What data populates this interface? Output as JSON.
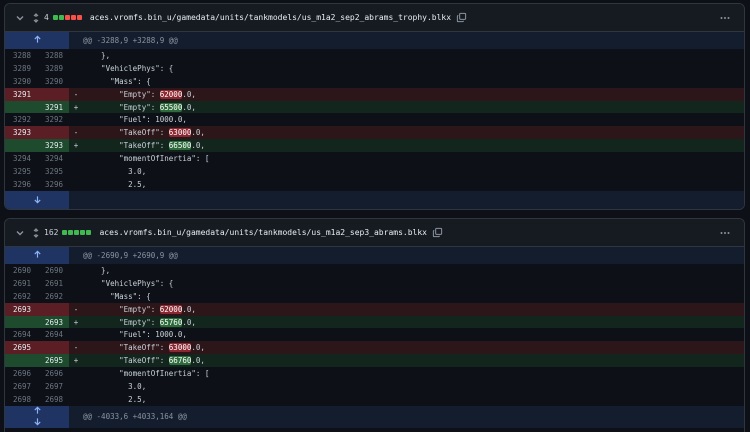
{
  "files": [
    {
      "count": "4",
      "filename": "aces.vromfs.bin_u/gamedata/units/tankmodels/us_m1a2_sep2_abrams_trophy.blkx",
      "diffstat": [
        "add",
        "add",
        "del",
        "del",
        "del"
      ],
      "hunk_top": "@@ -3288,9 +3288,9 @@",
      "lines": [
        {
          "type": "ctx",
          "old": "3288",
          "new": "3288",
          "mark": "",
          "pre": "    },",
          "hl": "",
          "post": ""
        },
        {
          "type": "ctx",
          "old": "3289",
          "new": "3289",
          "mark": "",
          "pre": "    \"VehiclePhys\": {",
          "hl": "",
          "post": ""
        },
        {
          "type": "ctx",
          "old": "3290",
          "new": "3290",
          "mark": "",
          "pre": "      \"Mass\": {",
          "hl": "",
          "post": ""
        },
        {
          "type": "del",
          "old": "3291",
          "new": "",
          "mark": "-",
          "pre": "        \"Empty\": ",
          "hl": "62000",
          "post": ".0,"
        },
        {
          "type": "add",
          "old": "",
          "new": "3291",
          "mark": "+",
          "pre": "        \"Empty\": ",
          "hl": "65500",
          "post": ".0,"
        },
        {
          "type": "ctx",
          "old": "3292",
          "new": "3292",
          "mark": "",
          "pre": "        \"Fuel\": 1000.0,",
          "hl": "",
          "post": ""
        },
        {
          "type": "del",
          "old": "3293",
          "new": "",
          "mark": "-",
          "pre": "        \"TakeOff\": ",
          "hl": "63000",
          "post": ".0,"
        },
        {
          "type": "add",
          "old": "",
          "new": "3293",
          "mark": "+",
          "pre": "        \"TakeOff\": ",
          "hl": "66500",
          "post": ".0,"
        },
        {
          "type": "ctx",
          "old": "3294",
          "new": "3294",
          "mark": "",
          "pre": "        \"momentOfInertia\": [",
          "hl": "",
          "post": ""
        },
        {
          "type": "ctx",
          "old": "3295",
          "new": "3295",
          "mark": "",
          "pre": "          3.0,",
          "hl": "",
          "post": ""
        },
        {
          "type": "ctx",
          "old": "3296",
          "new": "3296",
          "mark": "",
          "pre": "          2.5,",
          "hl": "",
          "post": ""
        }
      ],
      "hunk_bottom": ""
    },
    {
      "count": "162",
      "filename": "aces.vromfs.bin_u/gamedata/units/tankmodels/us_m1a2_sep3_abrams.blkx",
      "diffstat": [
        "add",
        "add",
        "add",
        "add",
        "add"
      ],
      "hunk_top": "@@ -2690,9 +2690,9 @@",
      "lines": [
        {
          "type": "ctx",
          "old": "2690",
          "new": "2690",
          "mark": "",
          "pre": "    },",
          "hl": "",
          "post": ""
        },
        {
          "type": "ctx",
          "old": "2691",
          "new": "2691",
          "mark": "",
          "pre": "    \"VehiclePhys\": {",
          "hl": "",
          "post": ""
        },
        {
          "type": "ctx",
          "old": "2692",
          "new": "2692",
          "mark": "",
          "pre": "      \"Mass\": {",
          "hl": "",
          "post": ""
        },
        {
          "type": "del",
          "old": "2693",
          "new": "",
          "mark": "-",
          "pre": "        \"Empty\": ",
          "hl": "62000",
          "post": ".0,"
        },
        {
          "type": "add",
          "old": "",
          "new": "2693",
          "mark": "+",
          "pre": "        \"Empty\": ",
          "hl": "65760",
          "post": ".0,"
        },
        {
          "type": "ctx",
          "old": "2694",
          "new": "2694",
          "mark": "",
          "pre": "        \"Fuel\": 1000.0,",
          "hl": "",
          "post": ""
        },
        {
          "type": "del",
          "old": "2695",
          "new": "",
          "mark": "-",
          "pre": "        \"TakeOff\": ",
          "hl": "63000",
          "post": ".0,"
        },
        {
          "type": "add",
          "old": "",
          "new": "2695",
          "mark": "+",
          "pre": "        \"TakeOff\": ",
          "hl": "66760",
          "post": ".0,"
        },
        {
          "type": "ctx",
          "old": "2696",
          "new": "2696",
          "mark": "",
          "pre": "        \"momentOfInertia\": [",
          "hl": "",
          "post": ""
        },
        {
          "type": "ctx",
          "old": "2697",
          "new": "2697",
          "mark": "",
          "pre": "          3.0,",
          "hl": "",
          "post": ""
        },
        {
          "type": "ctx",
          "old": "2698",
          "new": "2698",
          "mark": "",
          "pre": "          2.5,",
          "hl": "",
          "post": ""
        }
      ],
      "hunk_bottom": "@@ -4033,6 +4033,164 @@"
    }
  ],
  "colors": {
    "add_block": "#3fb950",
    "del_block": "#f85149",
    "neutral_block": "#30363d"
  },
  "icons": [
    "chevron-down-icon",
    "expand-icon",
    "copy-icon",
    "kebab-icon",
    "expand-up-icon",
    "expand-down-icon"
  ]
}
